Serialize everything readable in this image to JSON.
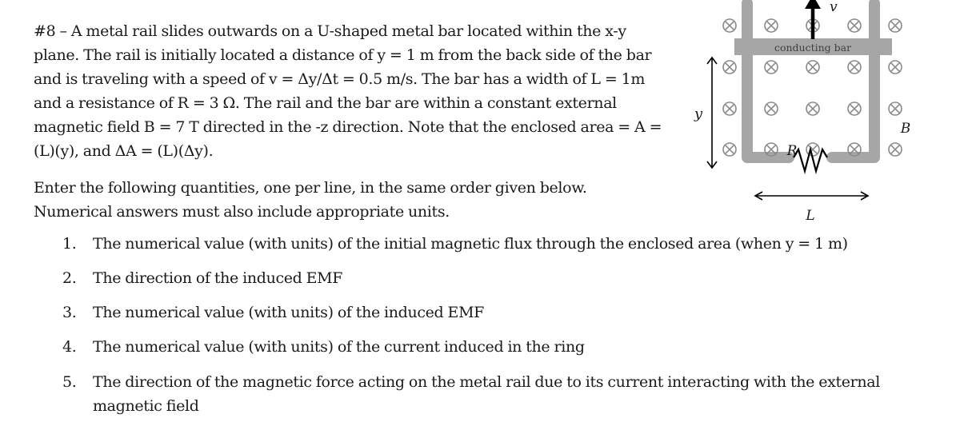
{
  "problem": {
    "intro_lines": [
      "#8 – A metal rail slides outwards on a U-shaped metal bar located within the x-y",
      "plane. The rail is initially located a distance of y = 1 m from the back side of the bar",
      "and is traveling with a speed of v = Δy/Δt = 0.5 m/s. The bar has a width of L = 1m",
      "and a resistance of R = 3 Ω. The rail and the bar are within a constant external",
      "magnetic field B = 7 T directed in the -z direction. Note that the enclosed area = A =",
      "(L)(y), and ΔA = (L)(Δy)."
    ],
    "instruction_lines": [
      "Enter the following quantities, one per line, in the same order given below.",
      "Numerical answers must also include appropriate units."
    ],
    "questions": [
      {
        "number": "1.",
        "text": "The numerical value (with units) of the initial magnetic flux through the enclosed area (when y = 1 m)"
      },
      {
        "number": "2.",
        "text": "The direction of the induced EMF"
      },
      {
        "number": "3.",
        "text": "The numerical value (with units) of the induced EMF"
      },
      {
        "number": "4.",
        "text": "The numerical value (with units) of the current induced in the ring"
      },
      {
        "number": "5.",
        "text": "The direction of the magnetic force acting on the metal rail due to its current interacting with the external magnetic field"
      }
    ]
  },
  "diagram": {
    "conducting_bar_label": "conducting bar",
    "velocity_label": "v",
    "position_label": "y",
    "field_label": "B",
    "resistor_label": "R",
    "width_label": "L",
    "field_symbol": "into-page-cross-icon",
    "colors": {
      "rail": "#a6a6a6",
      "bar": "#a6a6a6",
      "bar_text": "#404040",
      "field_symbol": "#8a8a8a",
      "arrows": "#000000",
      "text": "#1a1a1a"
    }
  }
}
